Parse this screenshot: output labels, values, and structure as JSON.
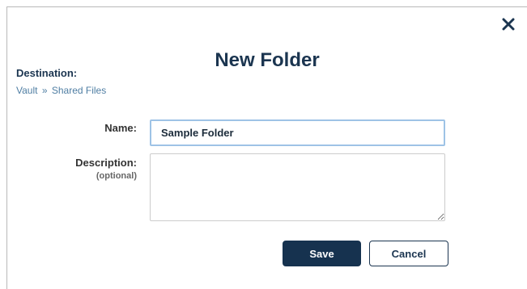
{
  "dialog": {
    "title": "New Folder",
    "close_icon": "close-icon"
  },
  "destination": {
    "label": "Destination:",
    "breadcrumb": {
      "root": "Vault",
      "separator": "»",
      "current": "Shared Files"
    }
  },
  "form": {
    "name_label": "Name:",
    "name_value": "Sample Folder",
    "description_label": "Description:",
    "description_hint": "(optional)",
    "description_value": ""
  },
  "buttons": {
    "save_label": "Save",
    "cancel_label": "Cancel"
  },
  "colors": {
    "primary": "#16324f",
    "link": "#4f7ea3",
    "focus_border": "#9ec3e6"
  }
}
